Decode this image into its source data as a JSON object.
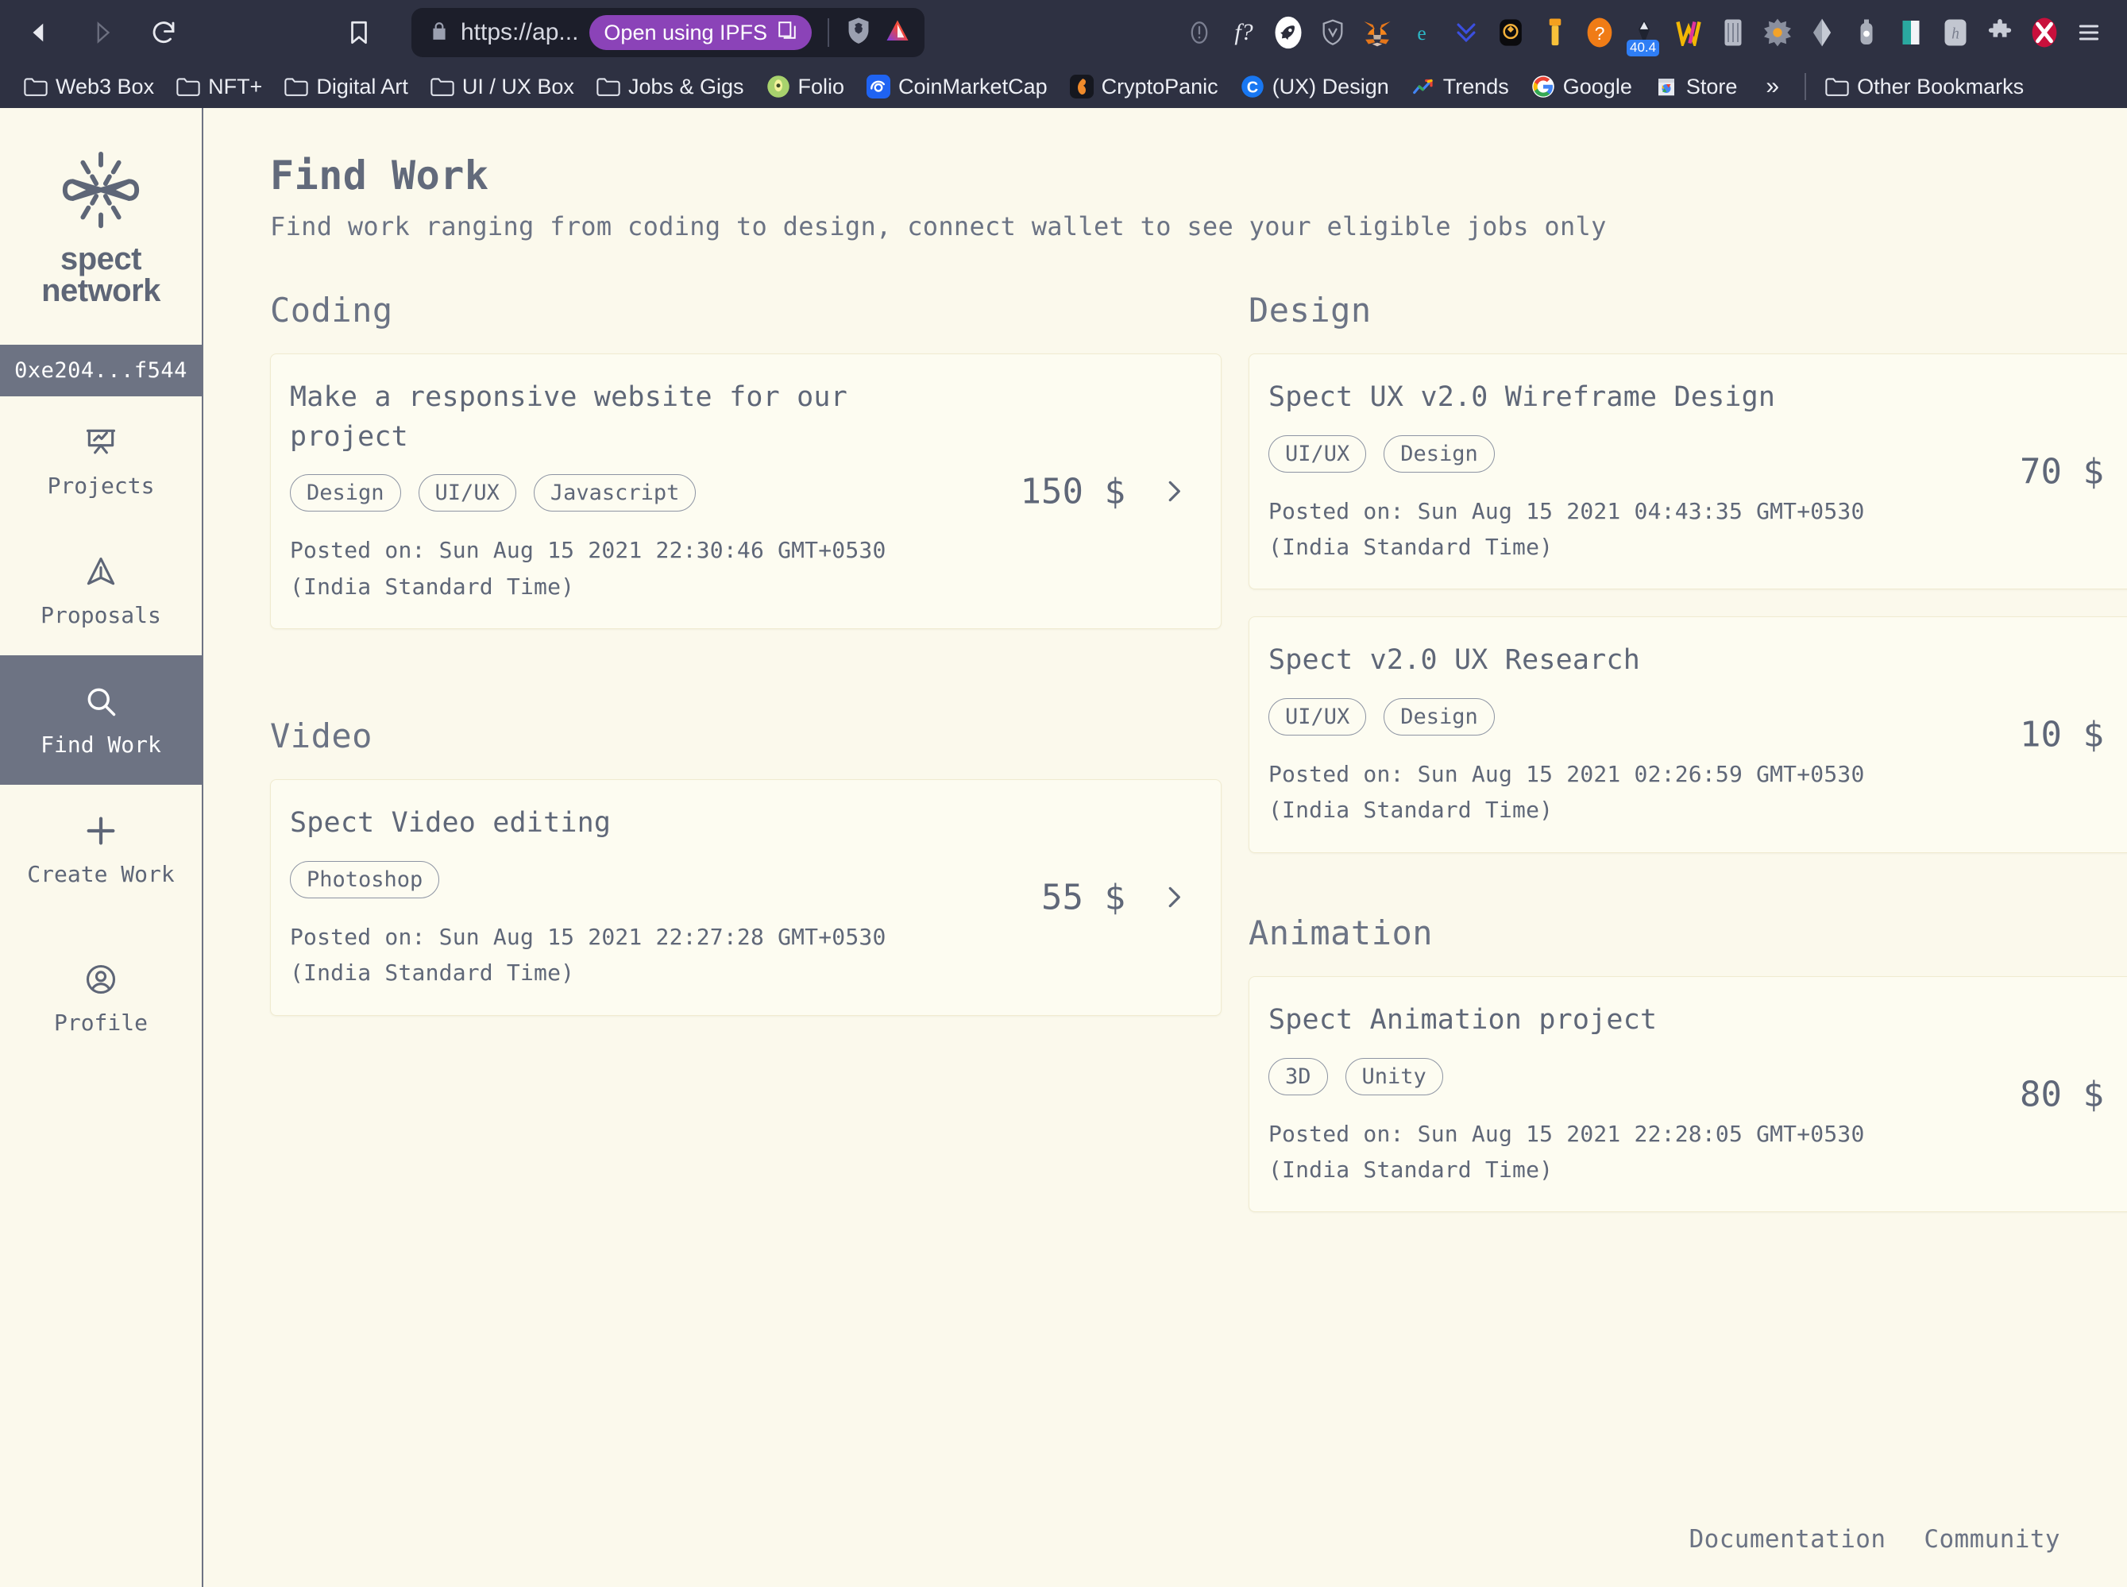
{
  "browser": {
    "nav": {
      "back_label": "Back",
      "forward_label": "Forward",
      "reload_label": "Reload",
      "bookmark_label": "Bookmark this page"
    },
    "omnibox": {
      "lock_icon": "lock-icon",
      "url": "https://ap...",
      "ipfs_button_label": "Open using IPFS",
      "ipfs_icon": "copies-icon",
      "brave_shields_icon": "brave-shields-icon",
      "brave_rewards_icon": "brave-rewards-triangle-icon"
    },
    "extensions": [
      {
        "name": "info-icon",
        "glyph": "!"
      },
      {
        "name": "fonts-icon",
        "glyph": "f?"
      },
      {
        "name": "rocket-icon",
        "glyph": ""
      },
      {
        "name": "shield-v-icon",
        "glyph": ""
      },
      {
        "name": "metamask-fox-icon",
        "glyph": ""
      },
      {
        "name": "phantom-icon",
        "glyph": ""
      },
      {
        "name": "chevrons-down-icon",
        "glyph": ""
      },
      {
        "name": "wallet-guard-icon",
        "glyph": ""
      },
      {
        "name": "torch-icon",
        "glyph": ""
      },
      {
        "name": "pocket-universe-icon",
        "glyph": "?"
      },
      {
        "name": "rabby-wallet-icon",
        "glyph": "",
        "badge": "40.4"
      },
      {
        "name": "w-wallet-icon",
        "glyph": "W"
      },
      {
        "name": "ledger-icon",
        "glyph": ""
      },
      {
        "name": "sunburst-icon",
        "glyph": ""
      },
      {
        "name": "ethereum-diamond-icon",
        "glyph": ""
      },
      {
        "name": "coinbase-wallet-icon",
        "glyph": ""
      },
      {
        "name": "book-icon",
        "glyph": ""
      },
      {
        "name": "keplr-icon",
        "glyph": ""
      },
      {
        "name": "puzzle-extensions-icon",
        "glyph": ""
      },
      {
        "name": "x-red-icon",
        "glyph": ""
      },
      {
        "name": "browser-menu-icon",
        "glyph": ""
      }
    ],
    "bookmarks": [
      {
        "label": "Web3 Box",
        "icon": "folder-icon"
      },
      {
        "label": "NFT+",
        "icon": "folder-icon"
      },
      {
        "label": "Digital Art",
        "icon": "folder-icon"
      },
      {
        "label": "UI / UX Box",
        "icon": "folder-icon"
      },
      {
        "label": "Jobs & Gigs",
        "icon": "folder-icon"
      },
      {
        "label": "Folio",
        "icon": "folio-icon"
      },
      {
        "label": "CoinMarketCap",
        "icon": "coinmarketcap-icon"
      },
      {
        "label": "CryptoPanic",
        "icon": "cryptopanic-icon"
      },
      {
        "label": "(UX) Design",
        "icon": "ux-design-icon"
      },
      {
        "label": "Trends",
        "icon": "trends-icon"
      },
      {
        "label": "Google",
        "icon": "google-icon"
      },
      {
        "label": "Store",
        "icon": "chrome-store-icon"
      }
    ],
    "bookmarks_overflow_label": "»",
    "other_bookmarks": {
      "label": "Other Bookmarks",
      "icon": "folder-icon"
    }
  },
  "sidebar": {
    "logo": {
      "mark_icon": "spect-burst-icon",
      "wordmark": "spect\nnetwork"
    },
    "wallet": "0xe204...f544",
    "items": [
      {
        "label": "Projects",
        "icon": "presentation-chart-icon",
        "active": false
      },
      {
        "label": "Proposals",
        "icon": "paper-plane-icon",
        "active": false
      },
      {
        "label": "Find Work",
        "icon": "search-icon",
        "active": true
      },
      {
        "label": "Create Work",
        "icon": "plus-icon",
        "active": false
      },
      {
        "label": "Profile",
        "icon": "user-circle-icon",
        "active": false
      }
    ]
  },
  "main": {
    "title": "Find Work",
    "subtitle": "Find work ranging from coding to design, connect wallet to see your eligible jobs only",
    "posted_prefix": "Posted on:",
    "timezone_line": "(India Standard Time)",
    "currency": "$",
    "chevron_icon": "chevron-right-icon",
    "sections": [
      {
        "name": "Coding",
        "column": "left",
        "cards": [
          {
            "title": "Make a responsive website for our project",
            "tags": [
              "Design",
              "UI/UX",
              "Javascript"
            ],
            "price": "150",
            "posted": "Posted on: Sun Aug 15 2021 22:30:46 GMT+0530",
            "timezone": "(India Standard Time)"
          }
        ]
      },
      {
        "name": "Design",
        "column": "right",
        "cards": [
          {
            "title": "Spect UX v2.0 Wireframe Design",
            "tags": [
              "UI/UX",
              "Design"
            ],
            "price": "70",
            "posted": "Posted on: Sun Aug 15 2021 04:43:35 GMT+0530",
            "timezone": "(India Standard Time)"
          },
          {
            "title": "Spect v2.0 UX Research",
            "tags": [
              "UI/UX",
              "Design"
            ],
            "price": "10",
            "posted": "Posted on: Sun Aug 15 2021 02:26:59 GMT+0530",
            "timezone": "(India Standard Time)"
          }
        ]
      },
      {
        "name": "Video",
        "column": "left",
        "cards": [
          {
            "title": "Spect Video editing",
            "tags": [
              "Photoshop"
            ],
            "price": "55",
            "posted": "Posted on: Sun Aug 15 2021 22:27:28 GMT+0530",
            "timezone": "(India Standard Time)"
          }
        ]
      },
      {
        "name": "Animation",
        "column": "right",
        "cards": [
          {
            "title": "Spect Animation project",
            "tags": [
              "3D",
              "Unity"
            ],
            "price": "80",
            "posted": "Posted on: Sun Aug 15 2021 22:28:05 GMT+0530",
            "timezone": "(India Standard Time)"
          }
        ]
      }
    ]
  },
  "footer": {
    "links": [
      {
        "label": "Documentation"
      },
      {
        "label": "Community"
      }
    ]
  },
  "colors": {
    "page_background": "#fbf9ec",
    "card_background": "#fdfcf1",
    "card_border": "#f0ebd0",
    "text_primary": "#5f6778",
    "accent_slate": "#6d7383",
    "chrome_background": "#2e3142",
    "omnibox_background": "#1c1e2a",
    "ipfs_pill": "#8b43b8"
  }
}
